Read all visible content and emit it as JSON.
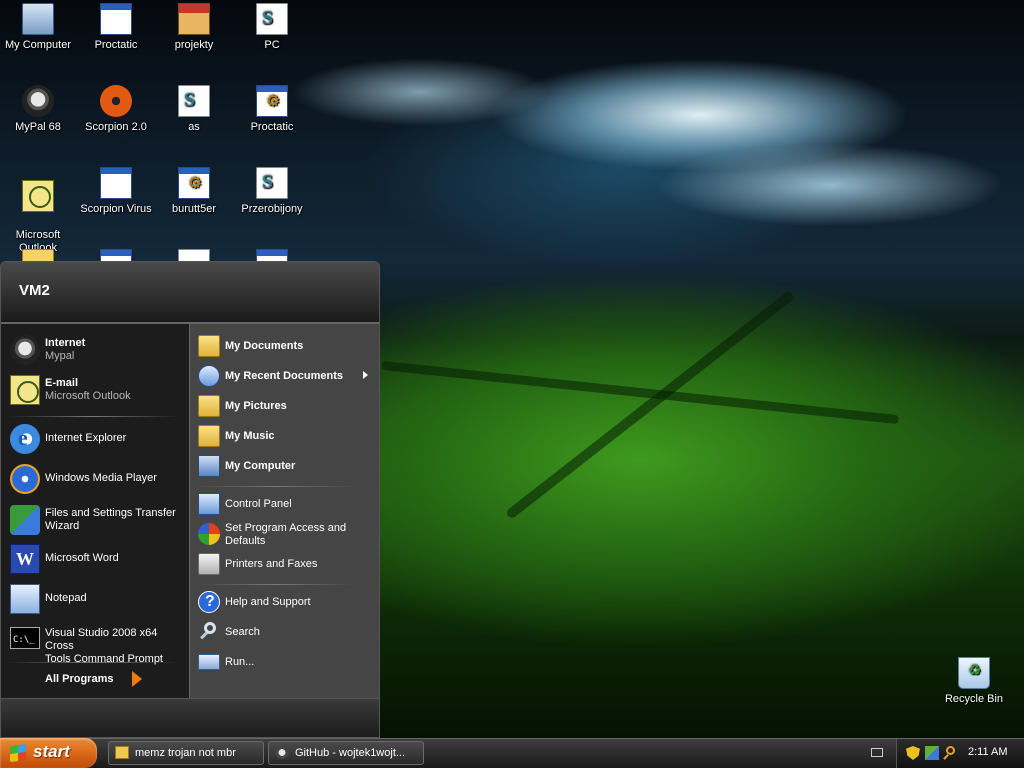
{
  "desktop": {
    "icons": [
      {
        "label": "My Computer",
        "icon": "my-computer-icon"
      },
      {
        "label": "Proctatic",
        "icon": "application-window-icon"
      },
      {
        "label": "projekty",
        "icon": "archive-box-icon"
      },
      {
        "label": "PC",
        "icon": "script-document-icon"
      },
      {
        "label": "MyPal 68",
        "icon": "mypal-raccoon-icon"
      },
      {
        "label": "Scorpion 2.0",
        "icon": "biohazard-icon"
      },
      {
        "label": "as",
        "icon": "script-document-icon"
      },
      {
        "label": "Proctatic",
        "icon": "gear-window-icon"
      },
      {
        "label": "Microsoft\nOutlook",
        "icon": "outlook-icon"
      },
      {
        "label": "Scorpion Virus",
        "icon": "application-window-icon"
      },
      {
        "label": "burutt5er",
        "icon": "gear-window-icon"
      },
      {
        "label": "Przerobijony",
        "icon": "script-document-icon"
      },
      {
        "label": "Recycle Bin",
        "icon": "recycle-bin-icon"
      }
    ]
  },
  "start_menu": {
    "user_name": "VM2",
    "pinned": [
      {
        "title": "Internet",
        "subtitle": "Mypal",
        "icon": "mypal-raccoon-icon"
      },
      {
        "title": "E-mail",
        "subtitle": "Microsoft Outlook",
        "icon": "outlook-icon"
      }
    ],
    "recent": [
      {
        "label": "Internet Explorer",
        "icon": "internet-explorer-icon"
      },
      {
        "label": "Windows Media Player",
        "icon": "media-player-icon"
      },
      {
        "label": "Files and Settings Transfer\nWizard",
        "icon": "transfer-wizard-icon"
      },
      {
        "label": "Microsoft Word",
        "icon": "word-icon"
      },
      {
        "label": "Notepad",
        "icon": "notepad-icon"
      },
      {
        "label": "Visual Studio 2008 x64 Cross\nTools Command Prompt",
        "icon": "command-prompt-icon"
      }
    ],
    "all_programs": "All Programs",
    "places": [
      {
        "label": "My Documents",
        "icon": "folder-icon"
      },
      {
        "label": "My Recent Documents",
        "icon": "recent-documents-icon"
      },
      {
        "label": "My Pictures",
        "icon": "pictures-folder-icon"
      },
      {
        "label": "My Music",
        "icon": "music-folder-icon"
      },
      {
        "label": "My Computer",
        "icon": "my-computer-icon"
      }
    ],
    "system": [
      {
        "label": "Control Panel",
        "icon": "control-panel-icon"
      },
      {
        "label": "Set Program Access and\nDefaults",
        "icon": "program-access-icon"
      },
      {
        "label": "Printers and Faxes",
        "icon": "printer-icon"
      }
    ],
    "help": [
      {
        "label": "Help and Support",
        "icon": "help-icon"
      },
      {
        "label": "Search",
        "icon": "search-icon"
      },
      {
        "label": "Run...",
        "icon": "run-icon"
      }
    ]
  },
  "taskbar": {
    "start_label": "start",
    "tasks": [
      {
        "label": "memz trojan not mbr",
        "icon": "folder-icon"
      },
      {
        "label": "GitHub - wojtek1wojt...",
        "icon": "mypal-raccoon-icon"
      }
    ],
    "clock": "2:11 AM"
  }
}
